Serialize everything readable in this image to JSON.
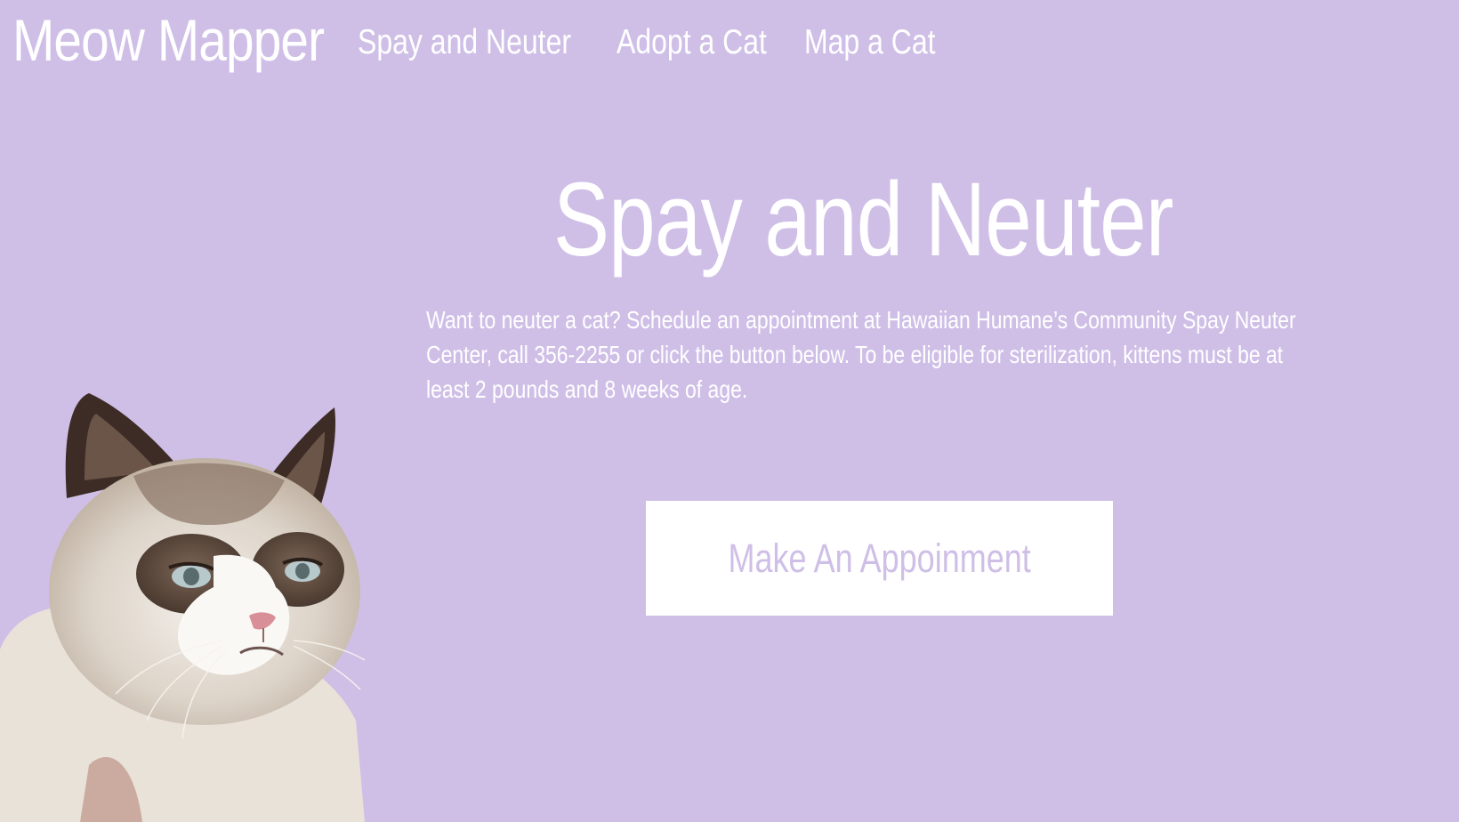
{
  "header": {
    "brand": "Meow Mapper",
    "nav": [
      {
        "label": "Spay and Neuter"
      },
      {
        "label": "Adopt a Cat"
      },
      {
        "label": "Map a Cat"
      }
    ]
  },
  "hero": {
    "title": "Spay and Neuter",
    "text": "Want to neuter a cat? Schedule an appointment at Hawaiian Humane’s Community Spay Neuter Center, call 356-2255 or click the button below. To be eligible for sterilization, kittens must be at least 2 pounds and 8 weeks of age.",
    "button_label": "Make An Appoinment"
  },
  "image": {
    "subject": "grumpy-cat-icon"
  },
  "colors": {
    "background": "#cfbfe7",
    "text": "#ffffff",
    "button_bg": "#ffffff",
    "button_text": "#cfbfe7"
  }
}
